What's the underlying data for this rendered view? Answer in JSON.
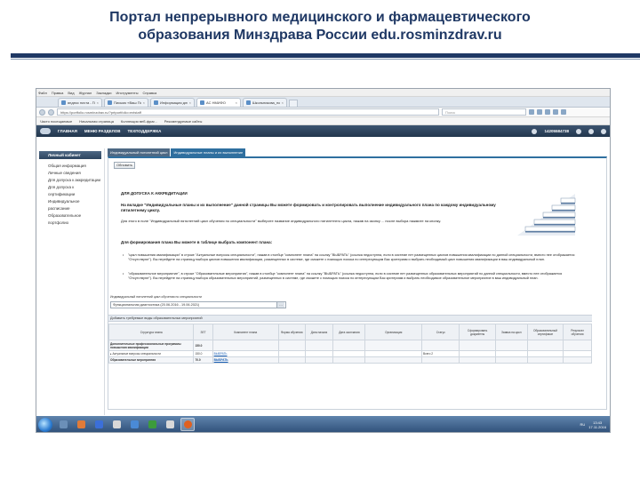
{
  "slide": {
    "title_line1": "Портал непрерывного медицинского и фармацевтического",
    "title_line2": "образования Минздрава России edu.rosminzdrav.ru"
  },
  "browser": {
    "menu": [
      "Файл",
      "Правка",
      "Вид",
      "Журнал",
      "Закладки",
      "Инструменты",
      "Справка"
    ],
    "tabs": [
      {
        "label": "яндекс почта - Поиск в Я..."
      },
      {
        "label": "Письмо «Ваш Портал не..."
      },
      {
        "label": "Информация для специ..."
      },
      {
        "label": "АС НМИФО",
        "active": true
      },
      {
        "label": "Школьникова_портфоли..."
      }
    ],
    "url": "https://portfolio.rosminzdrav.ru/?prtportfolio=extstaff",
    "search_placeholder": "Поиск",
    "bookmarks": [
      "Часто посещаемые",
      "Начальная страница",
      "Коллекция веб-фраг...",
      "Рекомендуемые сайты"
    ]
  },
  "site": {
    "nav": [
      "ГЛАВНАЯ",
      "МЕНЮ РАЗДЕЛОВ",
      "ТЕХПОДДЕРЖКА"
    ],
    "user_id": "14205584738",
    "sidebar_header": "Личный кабинет",
    "sidebar_items": [
      "Общая информация",
      "Личные сведения",
      "Для допуска к аккредитации",
      "Для допуска к сертификации",
      "Индивидуальное расписание",
      "Образовательное портфолио"
    ],
    "content_tabs": [
      "Индивидуальный пятилетний цикл",
      "Индивидуальные планы и их выполнение"
    ],
    "refresh_button": "Обновить",
    "info_heading": "ДЛЯ ДОПУСКА К АККРЕДИТАЦИИ",
    "info_p1": "На вкладке \"Индивидуальные планы и их выполнение\" данной страницы Вы можете формировать и контролировать выполнение индивидуального плана по каждому индивидуальному пятилетнему циклу.",
    "info_p2": "Для этого в поле \"Индивидуальный пятилетний цикл обучения по специальности\" выберите название индивидуального пятилетнего цикла, нажав на иконку ... после выбора нажмите на кнопку.",
    "form_heading": "Для формирования плана Вы можете в таблице выбрать компонент плана:",
    "bullet1": "\"цикл повышения квалификации\" в строке \"Актуальные вопросы специальности\", нажав в столбце \"компонент плана\" на ссылку \"ВЫБРАТЬ\" (ссылка недоступна, если в системе нет размещенных циклов повышения квалификации по данной специальности, вместо нее отображается \"Отсутствуют\"). Вы перейдете на страницу выбора циклов повышения квалификации, размещенных в системе, где сможете с помощью поиска по интересующим Вас критериям и выбрать необходимый цикл повышения квалификации в ваш индивидуальный план.",
    "bullet2": "\"образовательное мероприятие\", в строке \"Образовательные мероприятия\", нажав в столбце \"компонент плана\" на ссылку \"ВЫБРАТЬ\" (ссылка недоступна, если в системе нет размещенных образовательных мероприятий по данной специальности, вместо нее отображается \"Отсутствуют\"). Вы перейдете на страницу выбора образовательных мероприятий, размещенных в системе, где сможете с помощью поиска по интересующим Вас критериям и выбрать необходимое образовательное мероприятие в ваш индивидуальный план.",
    "plan_label": "Индивидуальный пятилетний цикл обучения по специальности",
    "plan_value": "Функциональная диагностика (20.06.2016 - 19.06.2021)",
    "add_label": "Добавить требуемые виды образовательных мероприятий",
    "table": {
      "headers": [
        "Структура плана",
        "ЗЕТ",
        "Компонент плана",
        "Форма обучения",
        "Дата начала",
        "Дата окончания",
        "Организация",
        "Статус",
        "Сформировать документы",
        "Заявка на цикл",
        "Образовательный сертификат",
        "Результат обучения"
      ],
      "rows": [
        {
          "structure": "Дополнительные профессиональные программы повышения квалификации",
          "zet": "150.0",
          "component": "",
          "status": ""
        },
        {
          "structure": "Актуальные вопросы специальности",
          "zet": "150.0",
          "component": "ВЫБРАТЬ",
          "status": "Всего 2"
        },
        {
          "structure": "Образовательные мероприятия",
          "zet": "70.0",
          "component": "ВЫБРАТЬ",
          "status": ""
        }
      ]
    }
  },
  "taskbar": {
    "tray_lang": "RU",
    "clock_time": "13:43",
    "clock_date": "17.11.2016",
    "app_colors": [
      "#6b8fb8",
      "#e07b39",
      "#3b6fd9",
      "#d8d8d8",
      "#4a8ad6",
      "#3c9b3c",
      "#d9d9d9",
      "#e06020"
    ]
  },
  "colors": {
    "title": "#1f3864",
    "site_header": "#2d4560",
    "accent_tab": "#2f6f9f"
  }
}
